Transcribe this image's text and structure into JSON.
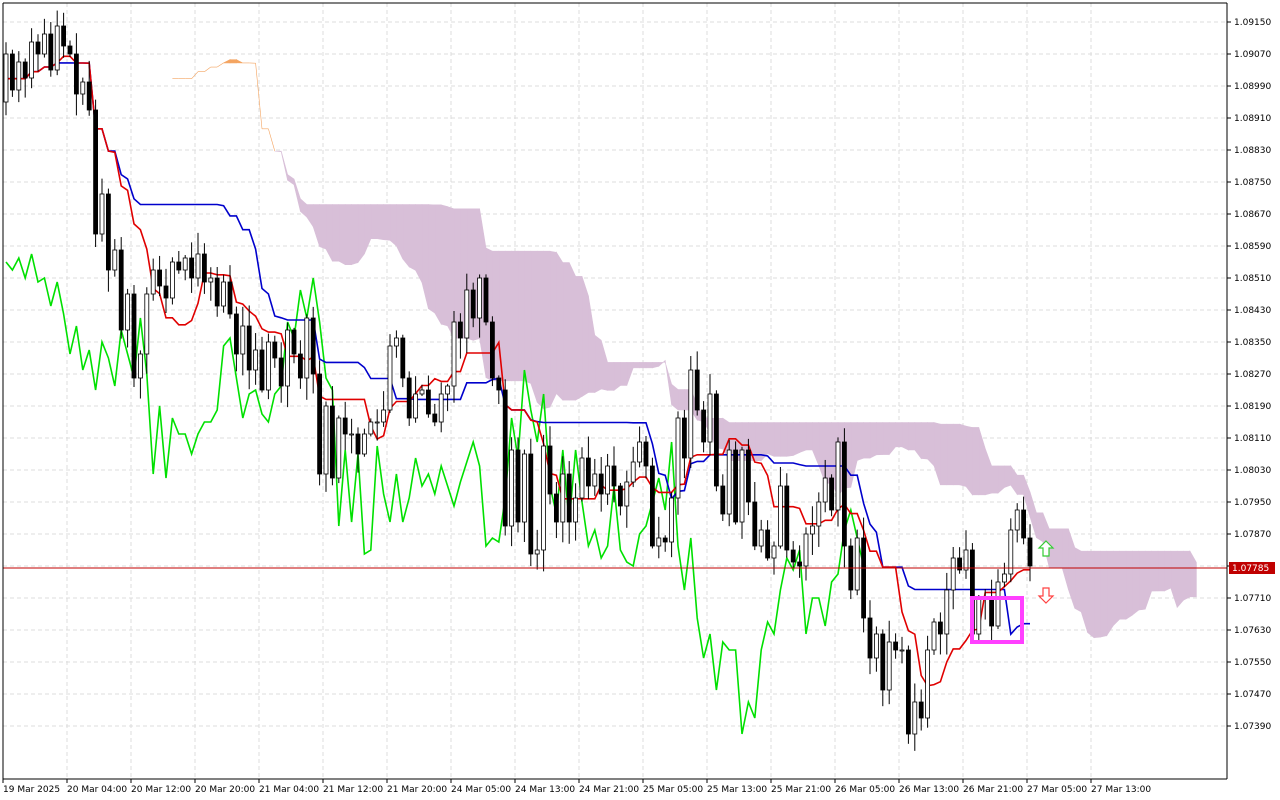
{
  "chart_data": {
    "type": "candlestick",
    "title": "",
    "xlabel": "",
    "ylabel": "",
    "ylim": [
      1.0732,
      1.0922
    ],
    "grid": true,
    "x_tick_labels": [
      "19 Mar 2025",
      "20 Mar 04:00",
      "20 Mar 12:00",
      "20 Mar 20:00",
      "21 Mar 04:00",
      "21 Mar 12:00",
      "21 Mar 20:00",
      "24 Mar 05:00",
      "24 Mar 13:00",
      "24 Mar 21:00",
      "25 Mar 05:00",
      "25 Mar 13:00",
      "25 Mar 21:00",
      "26 Mar 05:00",
      "26 Mar 13:00",
      "26 Mar 21:00",
      "27 Mar 05:00",
      "27 Mar 13:00"
    ],
    "y_tick_labels": [
      "1.09150",
      "1.09070",
      "1.08990",
      "1.08910",
      "1.08830",
      "1.08750",
      "1.08670",
      "1.08590",
      "1.08510",
      "1.08430",
      "1.08350",
      "1.08270",
      "1.08190",
      "1.08110",
      "1.08030",
      "1.07950",
      "1.07870",
      "1.07790",
      "1.07710",
      "1.07630",
      "1.07550",
      "1.07470",
      "1.07390"
    ],
    "current_price_label": "1.07785",
    "current_price": 1.07785,
    "close": [
      1.0907,
      1.0898,
      1.0905,
      1.0901,
      1.091,
      1.0907,
      1.0912,
      1.0903,
      1.0914,
      1.0909,
      1.0907,
      1.0897,
      1.09,
      1.0893,
      1.0862,
      1.0872,
      1.0853,
      1.0858,
      1.0838,
      1.0847,
      1.0826,
      1.0832,
      1.0847,
      1.0853,
      1.0849,
      1.0846,
      1.0855,
      1.0853,
      1.0856,
      1.0851,
      1.0857,
      1.085,
      1.0851,
      1.0844,
      1.085,
      1.0842,
      1.0832,
      1.0839,
      1.0828,
      1.0833,
      1.0823,
      1.0835,
      1.0831,
      1.0824,
      1.0838,
      1.0832,
      1.0826,
      1.0841,
      1.0827,
      1.0802,
      1.0819,
      1.0801,
      1.0816,
      1.0812,
      1.0812,
      1.0807,
      1.0812,
      1.0815,
      1.0815,
      1.0818,
      1.0834,
      1.0836,
      1.0826,
      1.0816,
      1.0822,
      1.0823,
      1.0817,
      1.0815,
      1.0822,
      1.0824,
      1.084,
      1.0836,
      1.0848,
      1.0841,
      1.0851,
      1.084,
      1.0826,
      1.0823,
      1.0789,
      1.0808,
      1.079,
      1.0807,
      1.0782,
      1.0783,
      1.0809,
      1.0797,
      1.079,
      1.0802,
      1.079,
      1.0796,
      1.0806,
      1.0799,
      1.0802,
      1.0797,
      1.0804,
      1.0799,
      1.0794,
      1.08,
      1.0805,
      1.081,
      1.0804,
      1.0784,
      1.0786,
      1.0785,
      1.0796,
      1.0816,
      1.0806,
      1.0828,
      1.0818,
      1.081,
      1.0822,
      1.0799,
      1.0792,
      1.0808,
      1.079,
      1.0808,
      1.0795,
      1.0784,
      1.0788,
      1.0781,
      1.0784,
      1.0799,
      1.0783,
      1.078,
      1.0779,
      1.0787,
      1.0789,
      1.0795,
      1.0801,
      1.0793,
      1.081,
      1.0784,
      1.0773,
      1.0786,
      1.0766,
      1.0756,
      1.0762,
      1.0748,
      1.076,
      1.0758,
      1.0758,
      1.0737,
      1.0745,
      1.0741,
      1.0758,
      1.0765,
      1.0762,
      1.0773,
      1.0781,
      1.0778,
      1.0783,
      1.0762,
      1.0771,
      1.0771,
      1.0764,
      1.0775,
      1.0777,
      1.0788,
      1.0793,
      1.0786,
      1.0779
    ]
  },
  "colors": {
    "background": "#ffffff",
    "grid": "#dcdcdc",
    "axis": "#000000",
    "candle_up_body": "#ffffff",
    "candle_down_body": "#000000",
    "candle_outline": "#000000",
    "tenkan_line": "#e00000",
    "kijun_line": "#0000cc",
    "chikou_line": "#00e000",
    "cloud_bearish": "#d8bfd8",
    "cloud_bullish": "#f4a460",
    "price_line": "#c00000",
    "highlight_box": "#ff40ff",
    "up_arrow": "#33cc33",
    "down_arrow": "#ff4040"
  },
  "icons": {
    "up_signal": "arrow-up-icon",
    "down_signal": "arrow-down-icon"
  }
}
